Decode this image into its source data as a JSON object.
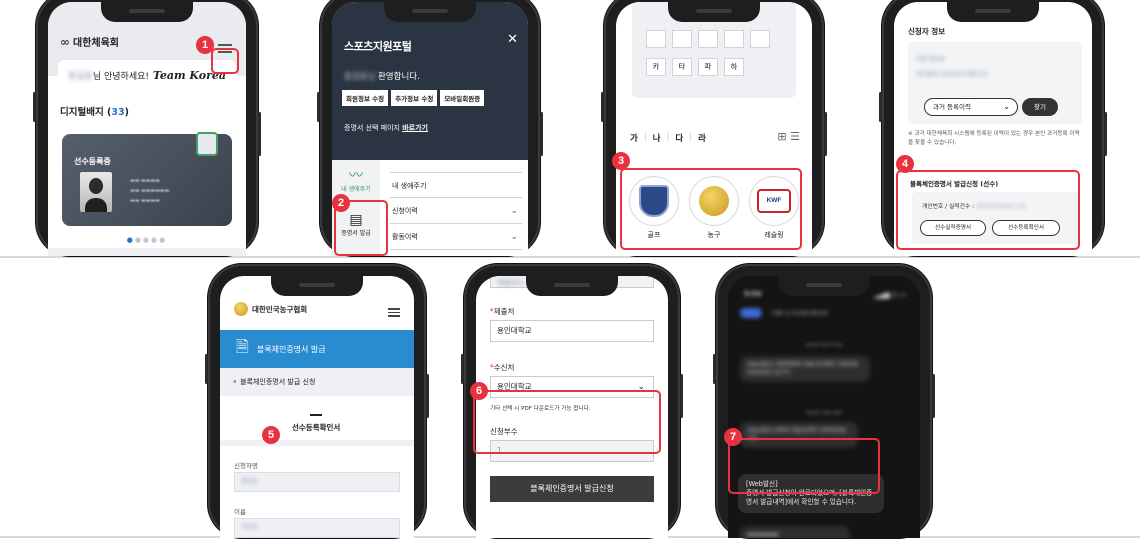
{
  "badges": [
    "1",
    "2",
    "3",
    "4",
    "5",
    "6",
    "7"
  ],
  "phone1": {
    "org_name": "대한체육회",
    "greeting": "님 안녕하세요!",
    "greeting_blur": "홍길동",
    "brand": "Team Korea",
    "digital_badge_label": "디지털배지",
    "digital_badge_count": "33",
    "card_label": "선수등록증"
  },
  "phone2": {
    "brand": "스포츠지원포털",
    "welcome": "환영합니다.",
    "welcome_blur": "홍길동님",
    "buttons": [
      "회원정보 수정",
      "추가정보 수정",
      "모바일회원증"
    ],
    "cert_prefix": "증명서 선택 페이지",
    "cert_link": "바로가기",
    "nav": [
      {
        "icon": "〰",
        "label": "내 생애주기"
      },
      {
        "icon": "▤",
        "label": "증명서 발급"
      }
    ],
    "menu": [
      "내 생애주기",
      "신청이력",
      "활동이력"
    ]
  },
  "phone3": {
    "keys_row1": [
      "",
      "",
      "",
      "",
      ""
    ],
    "keys_row2": [
      "카",
      "타",
      "파",
      "하"
    ],
    "tabs": [
      "가",
      "나",
      "다",
      "라"
    ],
    "orgs": [
      {
        "name": "골프",
        "icon": "golf-emblem-icon"
      },
      {
        "name": "농구",
        "icon": "basketball-emblem-icon"
      },
      {
        "name": "레슬링",
        "icon": "wrestling-emblem-icon",
        "text": "KWF"
      }
    ]
  },
  "phone4": {
    "section_title": "신청자 정보",
    "blur1": "이름  홍길동",
    "blur2": "생년월일  2000년01월01일",
    "select_label": "과거 등록이력",
    "find_button": "찾기",
    "note": "※ 과거 대한체육회 시스템에 등록된 이력이 있는 경우 본인 과거등록 이력을 찾을 수 있습니다.",
    "cert_section": "블록체인증명서 발급신청 (선수)",
    "id_label": "개인번호 / 실적건수 :",
    "id_blur": "0000000000 / 00",
    "btn_a": "선수실적증명서",
    "btn_b": "선수등록확인서"
  },
  "phone5": {
    "assoc": "대한민국농구협회",
    "banner": "블록체인증명서 발급",
    "sub": "블록체인증명서 발급 신청",
    "doc": "선수등록확인서",
    "name_label": "신청자명",
    "name_blur": "홍길동",
    "label2": "이름",
    "value2": "국민준"
  },
  "phone6": {
    "top_blur": "제출용도",
    "submit_to_label": "제출처",
    "submit_to_value": "용인대학교",
    "recipient_label": "수신처",
    "recipient_value": "용인대학교",
    "hint": "기타 선택 시 PDF 다운로드가 가능 합니다.",
    "count_label": "신청부수",
    "count_value": "1",
    "submit_button": "블록체인증명서 발급신청"
  },
  "phone7": {
    "time": "5:54",
    "signal": "▂▄▆ ᯤ ▭",
    "number": "+82 2-2144-8114",
    "message": "[Web발신]\n증명서 발급신청이 완료되었으며, [블록체인증명서 발급내역]에서 확인할 수 있습니다.",
    "blur_msgs": [
      "[Web발신] 대한체육회 포털 본인확인 인증번호 [000000] 입니다.",
      "[Web발신] 증명서 발급신청이 완료되었습니다."
    ]
  }
}
